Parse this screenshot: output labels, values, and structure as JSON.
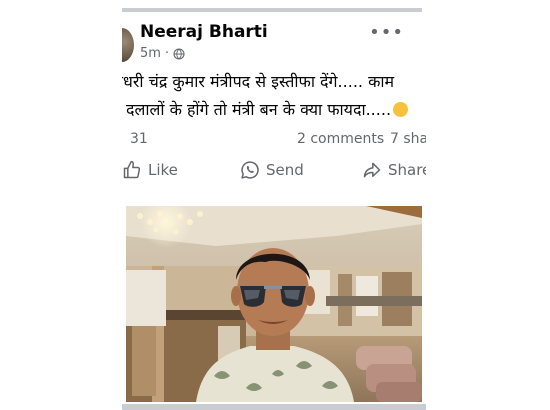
{
  "post": {
    "author": "Neeraj Bharti",
    "time": "5m",
    "privacy_icon": "globe-icon",
    "more_icon": "more-dots-icon",
    "text_line1": "वौधरी चंद्र कुमार मंत्रीपद से इस्तीफा देंगे..... काम",
    "text_line2": "दलालों के होंगे तो मंत्री बन के क्या फायदा.....",
    "emoji": "grinning-sweat-emoji"
  },
  "stats": {
    "reactions": "31",
    "comments": "2 comments",
    "shares": "7 sha"
  },
  "actions": {
    "like": "Like",
    "send": "Send",
    "share": "Share"
  },
  "colors": {
    "text": "#050505",
    "secondary": "#65676b",
    "divider": "#c9ccd1"
  }
}
